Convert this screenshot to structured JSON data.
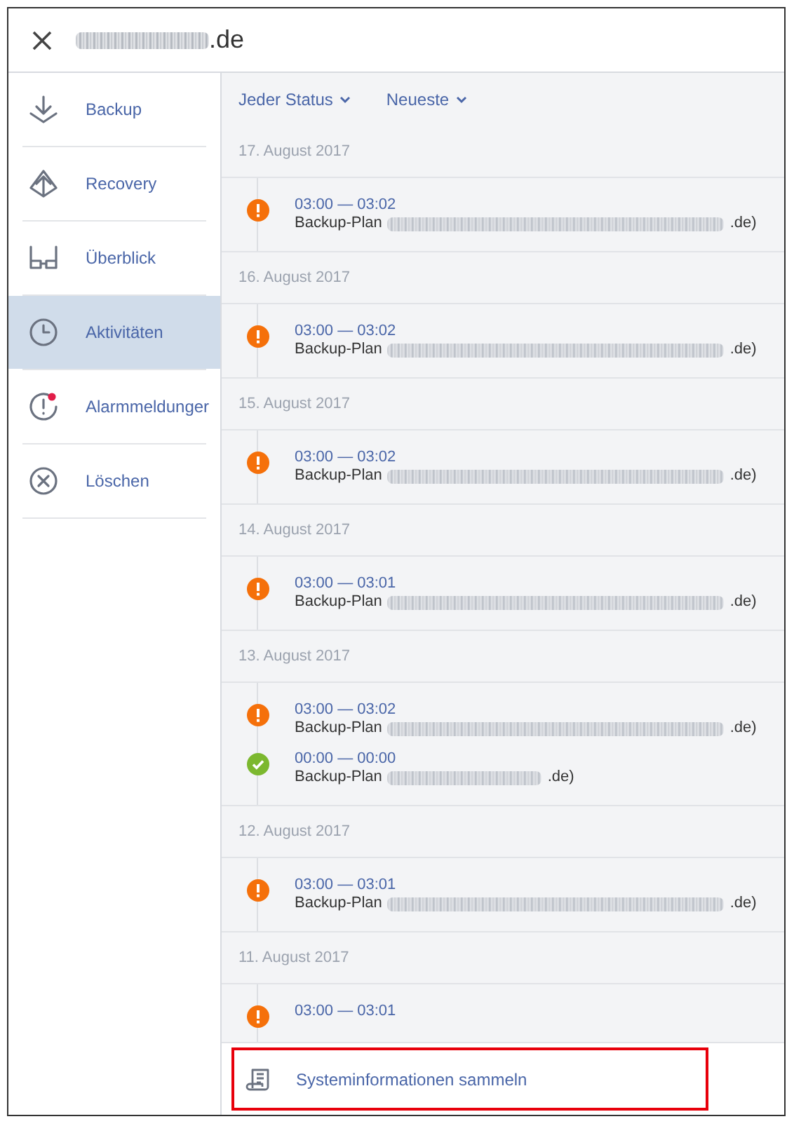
{
  "header": {
    "title_suffix": ".de"
  },
  "sidebar": {
    "items": [
      {
        "label": "Backup",
        "kind": "download",
        "selected": false,
        "alert": false
      },
      {
        "label": "Recovery",
        "kind": "upload",
        "selected": false,
        "alert": false
      },
      {
        "label": "Überblick",
        "kind": "glasses",
        "selected": false,
        "alert": false
      },
      {
        "label": "Aktivitäten",
        "kind": "clock",
        "selected": true,
        "alert": false
      },
      {
        "label": "Alarmmeldunger",
        "kind": "alert",
        "selected": false,
        "alert": true
      },
      {
        "label": "Löschen",
        "kind": "delete",
        "selected": false,
        "alert": false
      }
    ]
  },
  "filters": [
    {
      "label": "Jeder Status"
    },
    {
      "label": "Neueste"
    }
  ],
  "groups": [
    {
      "date": "17. August 2017",
      "entries": [
        {
          "kind": "warning",
          "time": "03:00 — 03:02",
          "plan": "Backup-Plan",
          "suffix": ".de)"
        }
      ]
    },
    {
      "date": "16. August 2017",
      "entries": [
        {
          "kind": "warning",
          "time": "03:00 — 03:02",
          "plan": "Backup-Plan",
          "suffix": ".de)"
        }
      ]
    },
    {
      "date": "15. August 2017",
      "entries": [
        {
          "kind": "warning",
          "time": "03:00 — 03:02",
          "plan": "Backup-Plan",
          "suffix": ".de)"
        }
      ]
    },
    {
      "date": "14. August 2017",
      "entries": [
        {
          "kind": "warning",
          "time": "03:00 — 03:01",
          "plan": "Backup-Plan",
          "suffix": ".de)"
        }
      ]
    },
    {
      "date": "13. August 2017",
      "entries": [
        {
          "kind": "warning",
          "time": "03:00 — 03:02",
          "plan": "Backup-Plan",
          "suffix": ".de)"
        },
        {
          "kind": "success",
          "time": "00:00 — 00:00",
          "plan": "Backup-Plan",
          "suffix": ".de)"
        }
      ]
    },
    {
      "date": "12. August 2017",
      "entries": [
        {
          "kind": "warning",
          "time": "03:00 — 03:01",
          "plan": "Backup-Plan",
          "suffix": ".de)"
        }
      ]
    },
    {
      "date": "11. August 2017",
      "entries": [
        {
          "kind": "warning",
          "time": "03:00 — 03:01"
        }
      ]
    }
  ],
  "footer": {
    "label": "Systeminformationen sammeln",
    "highlighted": true
  }
}
